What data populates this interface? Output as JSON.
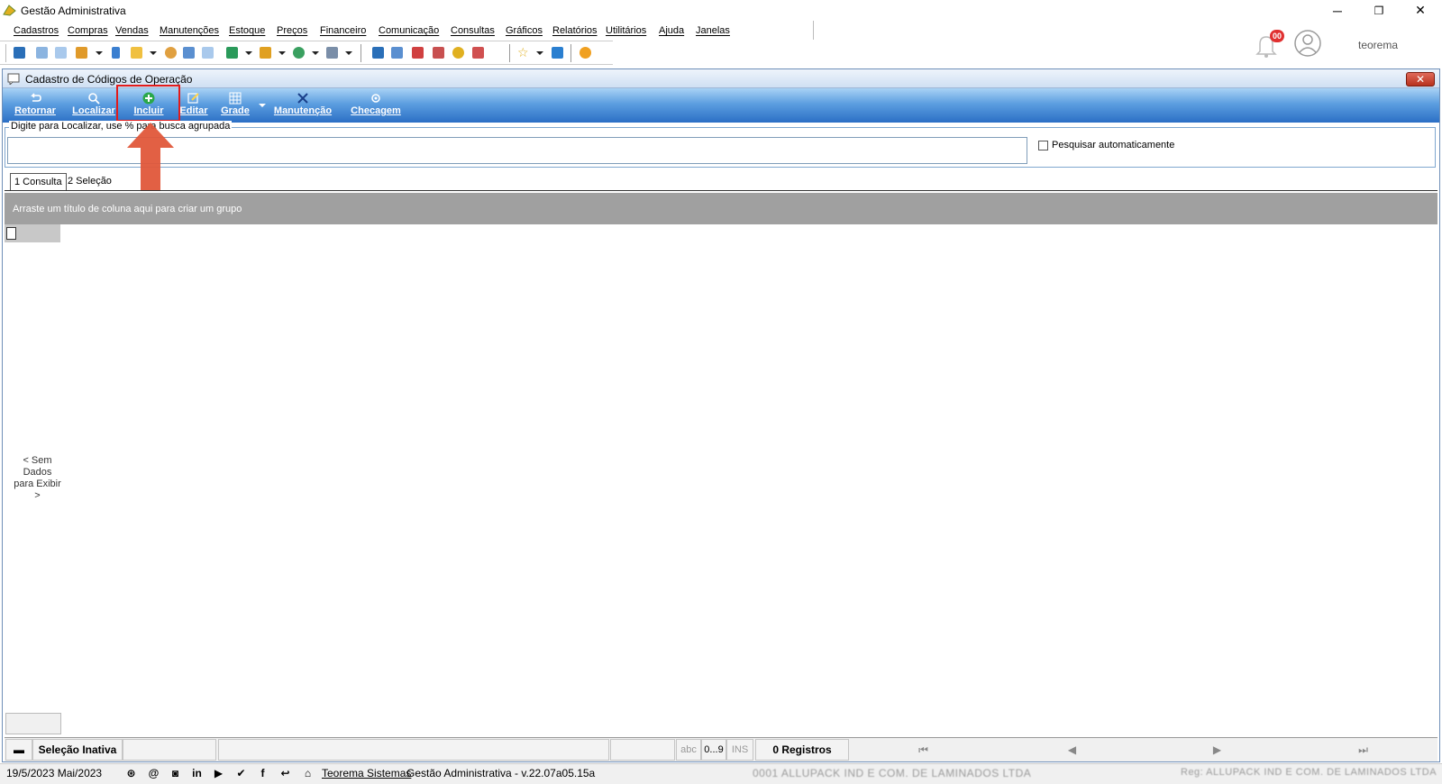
{
  "app": {
    "title": "Gestão Administrativa"
  },
  "menu": {
    "items": [
      "Cadastros",
      "Compras",
      "Vendas",
      "Manutenções",
      "Estoque",
      "Preços",
      "Financeiro",
      "Comunicação",
      "Consultas",
      "Gráficos",
      "Relatórios",
      "Utilitários",
      "Ajuda",
      "Janelas"
    ]
  },
  "user": {
    "name": "teorema",
    "notifications": "00"
  },
  "window": {
    "title": "Cadastro de Códigos de Operação",
    "close_label": "✕"
  },
  "ribbon": {
    "retornar": "Retornar",
    "localizar": "Localizar",
    "incluir": "Incluir",
    "editar": "Editar",
    "grade": "Grade",
    "manutencao": "Manutenção",
    "checagem": "Checagem"
  },
  "search": {
    "legend": "Digite para Localizar, use % para busca agrupada",
    "value": "",
    "auto_label": "Pesquisar automaticamente"
  },
  "tabs": {
    "consulta": "1 Consulta",
    "selecao": "2 Seleção"
  },
  "grid": {
    "group_hint": "Arraste um título de coluna aqui para criar um grupo",
    "no_data": "< Sem Dados para Exibir >"
  },
  "status": {
    "selection": "Seleção Inativa",
    "abc": "abc",
    "digits": "0...9",
    "ins": "INS",
    "records": "0 Registros",
    "nav_first": "⏮",
    "nav_prev": "◀",
    "nav_next": "▶",
    "nav_last": "⏭"
  },
  "footer": {
    "date": "19/5/2023 Mai/2023",
    "company_link": "Teorema Sistemas",
    "version": "Gestão Administrativa - v.22.07a05.15a",
    "company_name": "0001 ALLUPACK IND E COM. DE LAMINADOS LTDA",
    "registered": "Reg: ALLUPACK IND E COM. DE LAMINADOS LTDA"
  },
  "colors": {
    "ribbon_top": "#a9d2f5",
    "ribbon_bottom": "#2b6fc5",
    "highlight": "#e21b1b",
    "arrow": "#e0573a",
    "group_bar": "#a0a0a0"
  }
}
